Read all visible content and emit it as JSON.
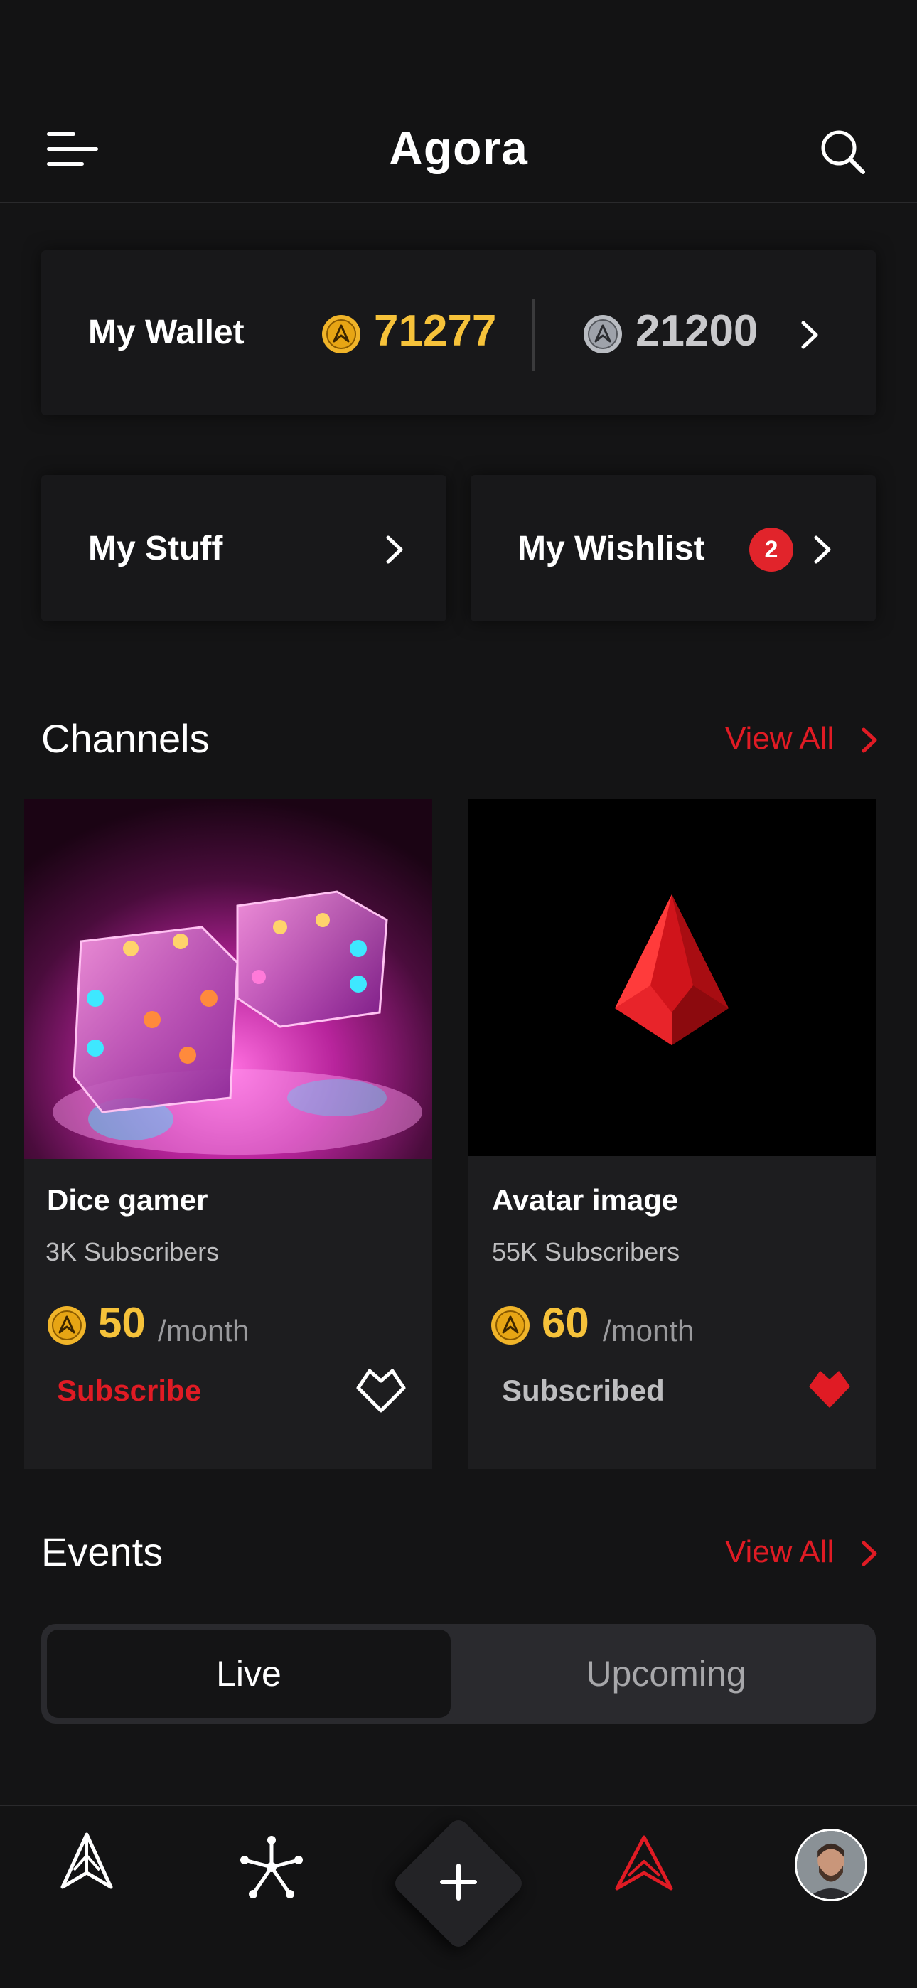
{
  "header": {
    "title": "Agora",
    "menu_icon": "menu-icon",
    "search_icon": "search-icon"
  },
  "wallet": {
    "label": "My Wallet",
    "gold_amount": "71277",
    "silver_amount": "21200",
    "gold_coin_icon": "gold-coin-icon",
    "silver_coin_icon": "silver-coin-icon"
  },
  "quick_links": {
    "stuff_label": "My Stuff",
    "wishlist_label": "My Wishlist",
    "wishlist_badge": "2"
  },
  "channels": {
    "title": "Channels",
    "view_all": "View All",
    "items": [
      {
        "name": "Dice gamer",
        "subscribers": "3K Subscribers",
        "price": "50",
        "period": "/month",
        "action": "Subscribe",
        "favorited": false
      },
      {
        "name": "Avatar image",
        "subscribers": "55K Subscribers",
        "price": "60",
        "period": "/month",
        "action": "Subscribed",
        "favorited": true
      }
    ]
  },
  "events": {
    "title": "Events",
    "view_all": "View All",
    "tabs": [
      {
        "label": "Live",
        "active": true
      },
      {
        "label": "Upcoming",
        "active": false
      }
    ]
  },
  "bottom_nav": {
    "items": [
      "home-icon",
      "network-icon",
      "add-icon",
      "agora-icon",
      "profile-avatar"
    ]
  },
  "colors": {
    "background": "#141415",
    "accent_red": "#e01b24",
    "gold": "#f6c23a"
  }
}
